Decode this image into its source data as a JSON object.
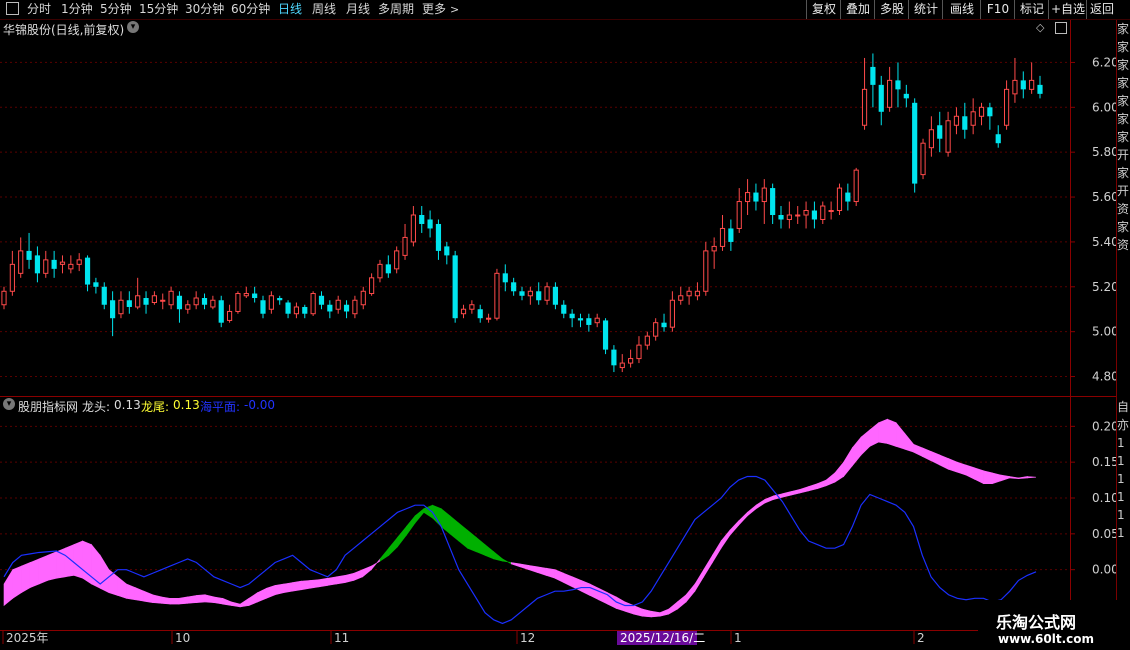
{
  "toolbar": {
    "window_icon": "window-icon",
    "periods": [
      "分时",
      "1分钟",
      "5分钟",
      "15分钟",
      "30分钟",
      "60分钟",
      "日线",
      "周线",
      "月线",
      "多周期",
      "更多"
    ],
    "active_period": "日线",
    "more_arrow": "chevron-right-icon",
    "buttons": [
      "复权",
      "叠加",
      "多股",
      "统计",
      "画线",
      "F10",
      "标记",
      "+自选",
      "返回"
    ]
  },
  "main_chart": {
    "title": "华锦股份(日线,前复权)",
    "dropdown_icon": "chevron-down-icon",
    "price_axis": [
      "6.20",
      "6.00",
      "5.80",
      "5.60",
      "5.40",
      "5.20",
      "5.00",
      "4.80"
    ],
    "diamond_icon": "diamond-icon",
    "layout_icon": "panel-toggle-icon"
  },
  "indicator": {
    "name": "股朋指标网",
    "dropdown_icon": "chevron-down-icon",
    "long_head_label": "龙头:",
    "long_head_value": "0.13",
    "long_tail_label": "龙尾:",
    "long_tail_value": "0.13",
    "sea_label": "海平面:",
    "sea_value": "-0.00",
    "axis": [
      "0.20",
      "0.15",
      "0.10",
      "0.05",
      "0.00"
    ]
  },
  "date_axis": {
    "labels": [
      "2025年",
      "10",
      "11",
      "12",
      "1",
      "2"
    ],
    "cursor_date": "2025/12/16/二"
  },
  "right_strip": {
    "top_chars": "家家家家家家家开家开资家资",
    "bottom_chars": "自亦111111"
  },
  "watermark": {
    "title": "乐淘公式网",
    "url": "www.60lt.com"
  },
  "colors": {
    "background": "#000000",
    "up_candle": "#ff4a4a",
    "down_candle": "#00e5ee",
    "grid": "#5a0000",
    "long_head_fill": "#ff66ff",
    "long_tail_fill": "#00b000",
    "sea_line": "#1a2fff",
    "axis_text": "#d0d0d0"
  },
  "chart_data": {
    "type": "candlestick",
    "title": "华锦股份(日线,前复权)",
    "ylim": [
      4.74,
      6.3
    ],
    "candles": [
      [
        5.12,
        5.18,
        5.1,
        5.2
      ],
      [
        5.18,
        5.3,
        5.16,
        5.36
      ],
      [
        5.26,
        5.36,
        5.24,
        5.42
      ],
      [
        5.36,
        5.32,
        5.28,
        5.44
      ],
      [
        5.34,
        5.26,
        5.22,
        5.38
      ],
      [
        5.26,
        5.32,
        5.24,
        5.36
      ],
      [
        5.32,
        5.28,
        5.24,
        5.36
      ],
      [
        5.3,
        5.31,
        5.26,
        5.34
      ],
      [
        5.28,
        5.3,
        5.26,
        5.34
      ],
      [
        5.3,
        5.32,
        5.27,
        5.35
      ],
      [
        5.33,
        5.21,
        5.18,
        5.34
      ],
      [
        5.22,
        5.2,
        5.17,
        5.24
      ],
      [
        5.2,
        5.12,
        5.1,
        5.22
      ],
      [
        5.14,
        5.06,
        4.98,
        5.18
      ],
      [
        5.08,
        5.14,
        5.06,
        5.18
      ],
      [
        5.14,
        5.11,
        5.08,
        5.18
      ],
      [
        5.11,
        5.16,
        5.1,
        5.24
      ],
      [
        5.15,
        5.12,
        5.08,
        5.18
      ],
      [
        5.13,
        5.16,
        5.12,
        5.18
      ],
      [
        5.14,
        5.14,
        5.1,
        5.17
      ],
      [
        5.12,
        5.18,
        5.1,
        5.2
      ],
      [
        5.16,
        5.1,
        5.04,
        5.18
      ],
      [
        5.1,
        5.12,
        5.08,
        5.14
      ],
      [
        5.12,
        5.15,
        5.1,
        5.18
      ],
      [
        5.15,
        5.12,
        5.1,
        5.17
      ],
      [
        5.11,
        5.14,
        5.1,
        5.16
      ],
      [
        5.14,
        5.04,
        5.02,
        5.16
      ],
      [
        5.05,
        5.09,
        5.04,
        5.12
      ],
      [
        5.09,
        5.17,
        5.08,
        5.18
      ],
      [
        5.16,
        5.17,
        5.15,
        5.2
      ],
      [
        5.17,
        5.15,
        5.13,
        5.2
      ],
      [
        5.14,
        5.08,
        5.06,
        5.16
      ],
      [
        5.1,
        5.16,
        5.08,
        5.18
      ],
      [
        5.15,
        5.14,
        5.12,
        5.16
      ],
      [
        5.13,
        5.08,
        5.06,
        5.14
      ],
      [
        5.08,
        5.11,
        5.06,
        5.13
      ],
      [
        5.11,
        5.08,
        5.06,
        5.12
      ],
      [
        5.08,
        5.17,
        5.07,
        5.18
      ],
      [
        5.16,
        5.12,
        5.1,
        5.18
      ],
      [
        5.12,
        5.09,
        5.06,
        5.14
      ],
      [
        5.1,
        5.14,
        5.08,
        5.16
      ],
      [
        5.12,
        5.09,
        5.06,
        5.14
      ],
      [
        5.08,
        5.14,
        5.06,
        5.16
      ],
      [
        5.12,
        5.18,
        5.1,
        5.2
      ],
      [
        5.17,
        5.24,
        5.16,
        5.26
      ],
      [
        5.24,
        5.3,
        5.22,
        5.32
      ],
      [
        5.3,
        5.26,
        5.24,
        5.34
      ],
      [
        5.28,
        5.36,
        5.26,
        5.38
      ],
      [
        5.34,
        5.42,
        5.32,
        5.48
      ],
      [
        5.4,
        5.52,
        5.38,
        5.56
      ],
      [
        5.52,
        5.48,
        5.44,
        5.56
      ],
      [
        5.5,
        5.46,
        5.42,
        5.54
      ],
      [
        5.48,
        5.36,
        5.32,
        5.5
      ],
      [
        5.38,
        5.34,
        5.3,
        5.4
      ],
      [
        5.34,
        5.06,
        5.04,
        5.36
      ],
      [
        5.08,
        5.1,
        5.06,
        5.12
      ],
      [
        5.1,
        5.12,
        5.08,
        5.14
      ],
      [
        5.1,
        5.06,
        5.04,
        5.12
      ],
      [
        5.06,
        5.06,
        5.04,
        5.08
      ],
      [
        5.06,
        5.26,
        5.05,
        5.28
      ],
      [
        5.26,
        5.22,
        5.18,
        5.3
      ],
      [
        5.22,
        5.18,
        5.16,
        5.24
      ],
      [
        5.18,
        5.16,
        5.14,
        5.2
      ],
      [
        5.16,
        5.18,
        5.12,
        5.2
      ],
      [
        5.18,
        5.14,
        5.12,
        5.22
      ],
      [
        5.14,
        5.2,
        5.12,
        5.22
      ],
      [
        5.2,
        5.12,
        5.1,
        5.22
      ],
      [
        5.12,
        5.08,
        5.06,
        5.14
      ],
      [
        5.08,
        5.06,
        5.02,
        5.1
      ],
      [
        5.06,
        5.05,
        5.02,
        5.08
      ],
      [
        5.06,
        5.03,
        5.0,
        5.08
      ],
      [
        5.04,
        5.06,
        5.02,
        5.08
      ],
      [
        5.05,
        4.92,
        4.9,
        5.06
      ],
      [
        4.92,
        4.85,
        4.82,
        4.94
      ],
      [
        4.84,
        4.86,
        4.82,
        4.9
      ],
      [
        4.86,
        4.88,
        4.84,
        4.92
      ],
      [
        4.88,
        4.94,
        4.86,
        4.98
      ],
      [
        4.94,
        4.98,
        4.92,
        5.0
      ],
      [
        4.98,
        5.04,
        4.96,
        5.06
      ],
      [
        5.04,
        5.02,
        5.0,
        5.08
      ],
      [
        5.02,
        5.14,
        5.0,
        5.18
      ],
      [
        5.14,
        5.16,
        5.12,
        5.2
      ],
      [
        5.16,
        5.18,
        5.12,
        5.2
      ],
      [
        5.16,
        5.18,
        5.14,
        5.22
      ],
      [
        5.18,
        5.36,
        5.16,
        5.4
      ],
      [
        5.36,
        5.38,
        5.28,
        5.42
      ],
      [
        5.38,
        5.46,
        5.36,
        5.52
      ],
      [
        5.46,
        5.4,
        5.36,
        5.5
      ],
      [
        5.46,
        5.58,
        5.44,
        5.64
      ],
      [
        5.58,
        5.62,
        5.52,
        5.68
      ],
      [
        5.62,
        5.58,
        5.54,
        5.66
      ],
      [
        5.58,
        5.64,
        5.48,
        5.68
      ],
      [
        5.64,
        5.52,
        5.48,
        5.66
      ],
      [
        5.52,
        5.5,
        5.46,
        5.56
      ],
      [
        5.5,
        5.52,
        5.46,
        5.58
      ],
      [
        5.52,
        5.52,
        5.48,
        5.56
      ],
      [
        5.52,
        5.54,
        5.46,
        5.58
      ],
      [
        5.54,
        5.5,
        5.46,
        5.58
      ],
      [
        5.5,
        5.56,
        5.48,
        5.58
      ],
      [
        5.54,
        5.54,
        5.5,
        5.58
      ],
      [
        5.54,
        5.64,
        5.52,
        5.66
      ],
      [
        5.62,
        5.58,
        5.54,
        5.66
      ],
      [
        5.58,
        5.72,
        5.56,
        5.73
      ],
      [
        5.92,
        6.08,
        5.9,
        6.22
      ],
      [
        6.18,
        6.1,
        6.0,
        6.24
      ],
      [
        6.1,
        5.98,
        5.92,
        6.14
      ],
      [
        6.0,
        6.12,
        5.98,
        6.18
      ],
      [
        6.12,
        6.08,
        6.0,
        6.2
      ],
      [
        6.06,
        6.04,
        6.0,
        6.1
      ],
      [
        6.02,
        5.66,
        5.62,
        6.04
      ],
      [
        5.7,
        5.84,
        5.68,
        5.86
      ],
      [
        5.82,
        5.9,
        5.78,
        5.96
      ],
      [
        5.92,
        5.86,
        5.8,
        5.98
      ],
      [
        5.8,
        5.94,
        5.78,
        5.98
      ],
      [
        5.92,
        5.96,
        5.88,
        6.0
      ],
      [
        5.96,
        5.9,
        5.86,
        6.02
      ],
      [
        5.92,
        5.98,
        5.88,
        6.04
      ],
      [
        5.96,
        6.0,
        5.92,
        6.02
      ],
      [
        6.0,
        5.96,
        5.9,
        6.02
      ],
      [
        5.88,
        5.84,
        5.82,
        5.92
      ],
      [
        5.92,
        6.08,
        5.9,
        6.12
      ],
      [
        6.06,
        6.12,
        6.02,
        6.22
      ],
      [
        6.12,
        6.08,
        6.04,
        6.16
      ],
      [
        6.08,
        6.12,
        6.06,
        6.2
      ],
      [
        6.1,
        6.06,
        6.04,
        6.14
      ]
    ],
    "indicator": {
      "ylim": [
        -0.08,
        0.22
      ],
      "long_head": [
        -0.02,
        0.0,
        0.005,
        0.01,
        0.015,
        0.02,
        0.025,
        0.03,
        0.035,
        0.04,
        0.035,
        0.02,
        0.0,
        -0.01,
        -0.02,
        -0.025,
        -0.03,
        -0.035,
        -0.038,
        -0.04,
        -0.04,
        -0.038,
        -0.036,
        -0.035,
        -0.038,
        -0.04,
        -0.045,
        -0.048,
        -0.04,
        -0.032,
        -0.026,
        -0.022,
        -0.02,
        -0.018,
        -0.016,
        -0.015,
        -0.014,
        -0.012,
        -0.01,
        -0.008,
        -0.005,
        0.0,
        0.005,
        0.012,
        0.02,
        0.032,
        0.048,
        0.065,
        0.08,
        0.072,
        0.06,
        0.05,
        0.04,
        0.03,
        0.025,
        0.02,
        0.015,
        0.012,
        0.01,
        0.008,
        0.006,
        0.004,
        0.002,
        0.0,
        -0.005,
        -0.01,
        -0.015,
        -0.02,
        -0.026,
        -0.032,
        -0.038,
        -0.045,
        -0.05,
        -0.055,
        -0.058,
        -0.06,
        -0.055,
        -0.045,
        -0.035,
        -0.02,
        0.0,
        0.02,
        0.04,
        0.055,
        0.068,
        0.08,
        0.09,
        0.098,
        0.103,
        0.106,
        0.109,
        0.112,
        0.116,
        0.12,
        0.125,
        0.135,
        0.15,
        0.17,
        0.185,
        0.195,
        0.205,
        0.21,
        0.205,
        0.19,
        0.175,
        0.17,
        0.165,
        0.16,
        0.155,
        0.15,
        0.146,
        0.142,
        0.138,
        0.135,
        0.132,
        0.13,
        0.128,
        0.13,
        0.129
      ],
      "long_tail": [
        -0.05,
        -0.04,
        -0.032,
        -0.025,
        -0.02,
        -0.015,
        -0.012,
        -0.01,
        -0.008,
        -0.012,
        -0.02,
        -0.026,
        -0.032,
        -0.036,
        -0.04,
        -0.042,
        -0.044,
        -0.046,
        -0.047,
        -0.048,
        -0.048,
        -0.047,
        -0.046,
        -0.045,
        -0.046,
        -0.048,
        -0.05,
        -0.052,
        -0.05,
        -0.045,
        -0.04,
        -0.035,
        -0.032,
        -0.03,
        -0.028,
        -0.026,
        -0.024,
        -0.022,
        -0.02,
        -0.018,
        -0.015,
        -0.01,
        0.0,
        0.015,
        0.03,
        0.045,
        0.06,
        0.075,
        0.085,
        0.09,
        0.085,
        0.075,
        0.065,
        0.055,
        0.045,
        0.035,
        0.025,
        0.015,
        0.008,
        0.004,
        0.0,
        -0.004,
        -0.008,
        -0.012,
        -0.018,
        -0.024,
        -0.03,
        -0.036,
        -0.042,
        -0.048,
        -0.054,
        -0.058,
        -0.062,
        -0.065,
        -0.066,
        -0.065,
        -0.062,
        -0.055,
        -0.045,
        -0.03,
        -0.01,
        0.01,
        0.03,
        0.048,
        0.062,
        0.075,
        0.085,
        0.093,
        0.098,
        0.101,
        0.104,
        0.107,
        0.11,
        0.113,
        0.117,
        0.122,
        0.13,
        0.145,
        0.16,
        0.172,
        0.178,
        0.176,
        0.172,
        0.168,
        0.164,
        0.158,
        0.152,
        0.146,
        0.14,
        0.136,
        0.132,
        0.126,
        0.12,
        0.12,
        0.124,
        0.128,
        0.127,
        0.128,
        0.129
      ],
      "sea_level": [
        -0.01,
        0.01,
        0.02,
        0.022,
        0.024,
        0.025,
        0.026,
        0.02,
        0.01,
        0.0,
        -0.01,
        -0.02,
        -0.01,
        0.0,
        0.0,
        -0.005,
        -0.01,
        -0.005,
        0.0,
        0.005,
        0.01,
        0.015,
        0.01,
        0.0,
        -0.01,
        -0.015,
        -0.02,
        -0.025,
        -0.02,
        -0.01,
        0.0,
        0.01,
        0.015,
        0.02,
        0.01,
        0.0,
        -0.005,
        -0.01,
        0.0,
        0.02,
        0.03,
        0.04,
        0.05,
        0.06,
        0.07,
        0.08,
        0.085,
        0.09,
        0.09,
        0.08,
        0.06,
        0.03,
        0.0,
        -0.02,
        -0.04,
        -0.06,
        -0.07,
        -0.075,
        -0.07,
        -0.06,
        -0.05,
        -0.04,
        -0.035,
        -0.03,
        -0.03,
        -0.028,
        -0.025,
        -0.025,
        -0.03,
        -0.035,
        -0.045,
        -0.05,
        -0.05,
        -0.045,
        -0.03,
        -0.01,
        0.01,
        0.03,
        0.05,
        0.07,
        0.08,
        0.09,
        0.1,
        0.115,
        0.125,
        0.13,
        0.13,
        0.125,
        0.11,
        0.095,
        0.075,
        0.055,
        0.04,
        0.035,
        0.03,
        0.03,
        0.035,
        0.06,
        0.09,
        0.105,
        0.1,
        0.095,
        0.09,
        0.08,
        0.06,
        0.02,
        -0.01,
        -0.025,
        -0.035,
        -0.04,
        -0.042,
        -0.04,
        -0.04,
        -0.045,
        -0.042,
        -0.03,
        -0.015,
        -0.008,
        -0.003
      ]
    }
  }
}
